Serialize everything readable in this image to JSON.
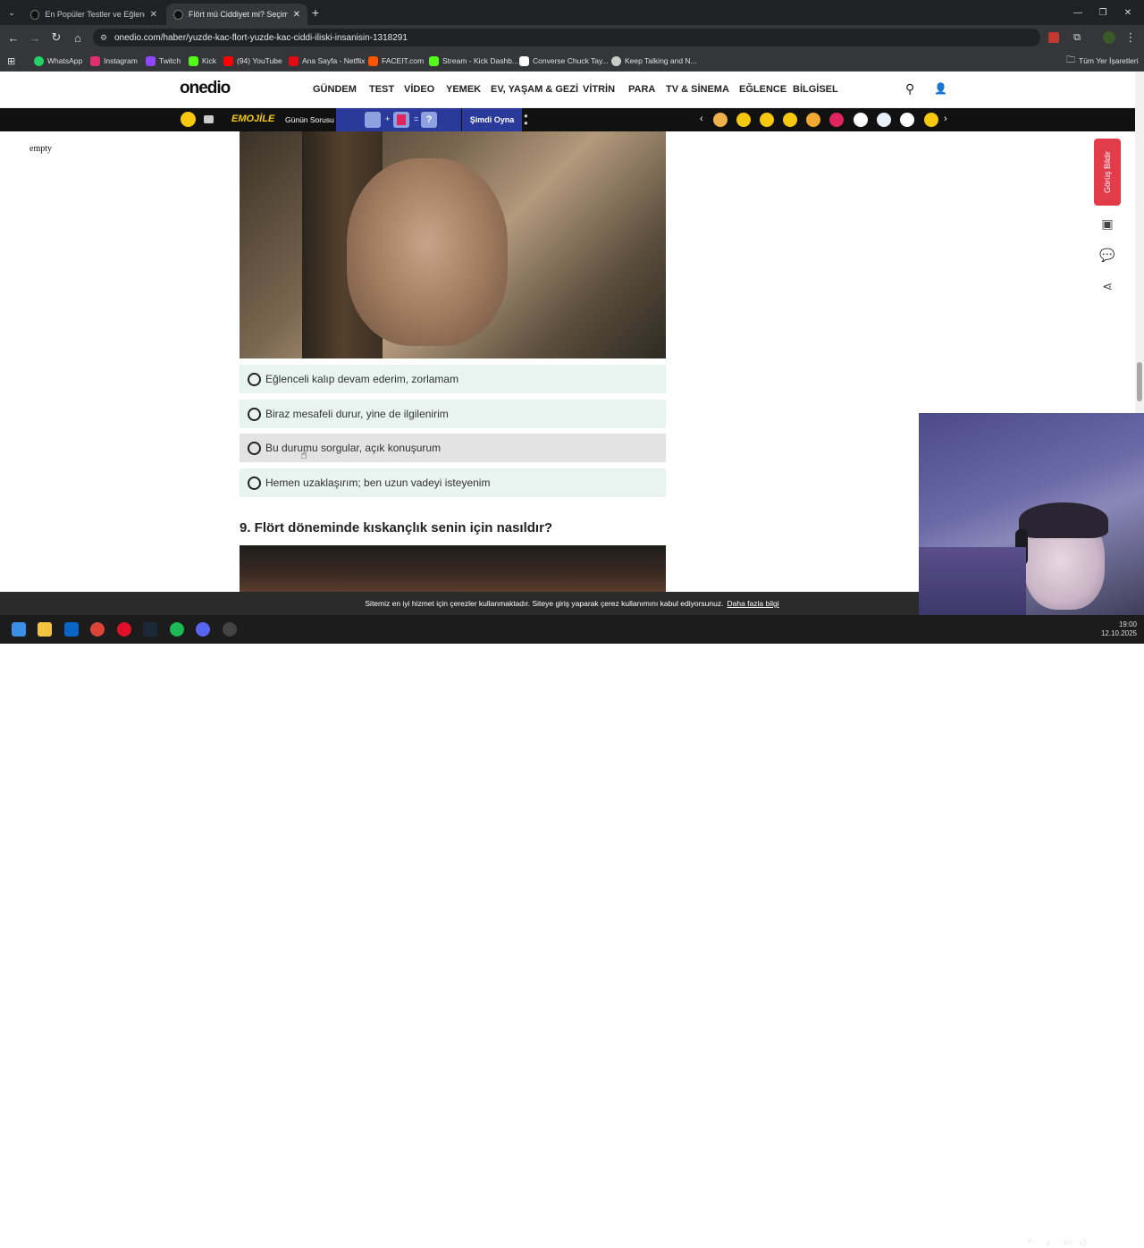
{
  "browser": {
    "tabs": [
      {
        "title": "En Popüler Testler ve Eğlenceli"
      },
      {
        "title": "Flört mü Ciddiyet mi? Seçimleri"
      }
    ],
    "new_tab": "+",
    "url": "onedio.com/haber/yuzde-kac-flort-yuzde-kac-ciddi-iliski-insanisin-1318291",
    "bookmarks": [
      {
        "label": "WhatsApp",
        "color": "#25d366"
      },
      {
        "label": "Instagram",
        "color": "#e1306c"
      },
      {
        "label": "Twitch",
        "color": "#9146ff"
      },
      {
        "label": "Kick",
        "color": "#53fc18"
      },
      {
        "label": "(94) YouTube",
        "color": "#ff0000"
      },
      {
        "label": "Ana Sayfa - Netflix",
        "color": "#e50914"
      },
      {
        "label": "FACEIT.com",
        "color": "#ff5500"
      },
      {
        "label": "Stream - Kick Dashb...",
        "color": "#53fc18"
      },
      {
        "label": "Converse Chuck Tay...",
        "color": "#ffffff"
      },
      {
        "label": "Keep Talking and N...",
        "color": "#cccccc"
      }
    ],
    "all_bookmarks": "Tüm Yer İşaretleri"
  },
  "site": {
    "logo": "onedio",
    "nav": [
      "GÜNDEM",
      "TEST",
      "VİDEO",
      "YEMEK",
      "EV, YAŞAM & GEZİ",
      "VİTRİN",
      "PARA",
      "TV & SİNEMA",
      "EĞLENCE",
      "BİLGİSEL"
    ],
    "emojile": {
      "brand": "EMOJİLE",
      "question": "Günün Sorusu",
      "q_mark": "?",
      "play": "Şimdi Oyna"
    },
    "left_text": "empty",
    "options": [
      "Eğlenceli kalıp devam ederim, zorlamam",
      "Biraz mesafeli durur, yine de ilgilenirim",
      "Bu durumu sorgular, açık konuşurum",
      "Hemen uzaklaşırım; ben uzun vadeyi isteyenim"
    ],
    "next_question": "9. Flört döneminde kıskançlık senin için nasıldır?",
    "report_button": "Görüş Bildir",
    "cookie_text": "Sitemiz en iyi hizmet için çerezler kullanmaktadır. Siteye giriş yaparak çerez kullanımını kabul ediyorsunuz.",
    "cookie_link": "Daha fazla bilgi"
  },
  "taskbar": {
    "time": "19:00",
    "date": "12.10.2025"
  },
  "colors": {
    "accent_red": "#e23c4b",
    "option_bg": "#e9f3ef"
  }
}
